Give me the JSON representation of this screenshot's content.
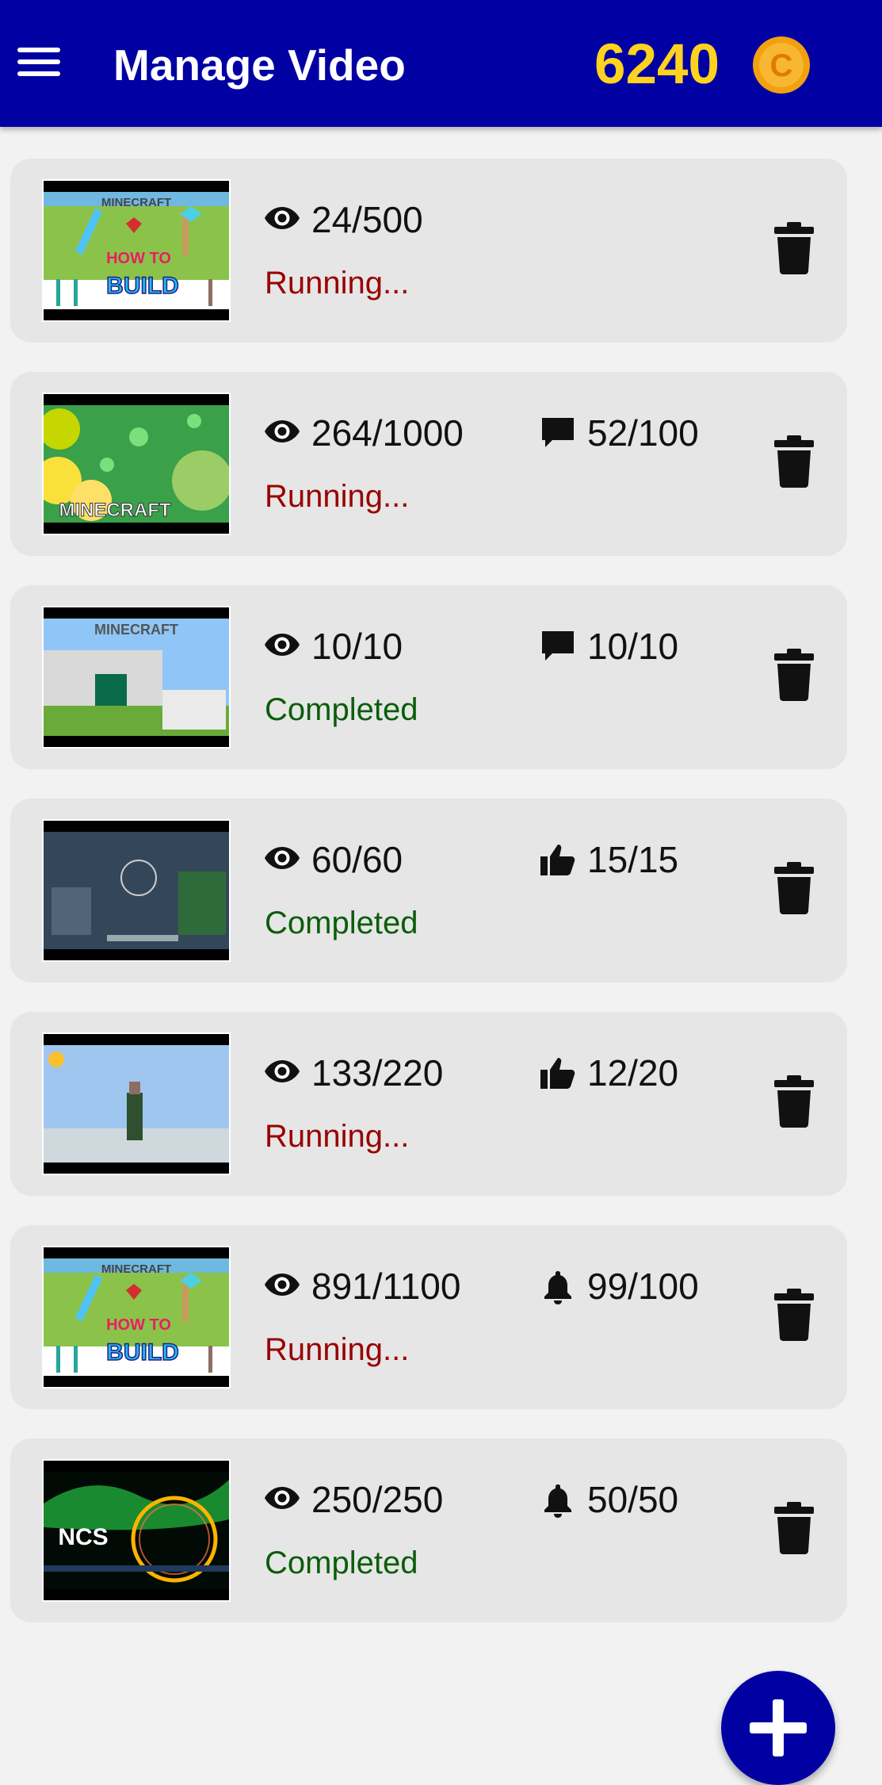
{
  "app": {
    "title": "Manage Video",
    "coins": "6240",
    "coin_symbol": "C"
  },
  "colors": {
    "appbar": "#0000a3",
    "coins": "#ffd21f",
    "running": "#990000",
    "completed": "#0b5d0b",
    "card": "#e6e6e6",
    "fab": "#0000a3"
  },
  "videos": [
    {
      "views": "24/500",
      "secondary": null,
      "status": "Running...",
      "state": "running",
      "thumb_label": "HOW TO BUILD"
    },
    {
      "views": "264/1000",
      "secondary": {
        "icon": "comment-icon",
        "value": "52/100"
      },
      "status": "Running...",
      "state": "running",
      "thumb_label": "MINECRAFT"
    },
    {
      "views": "10/10",
      "secondary": {
        "icon": "comment-icon",
        "value": "10/10"
      },
      "status": "Completed",
      "state": "completed",
      "thumb_label": "MINECRAFT"
    },
    {
      "views": "60/60",
      "secondary": {
        "icon": "thumbs-up-icon",
        "value": "15/15"
      },
      "status": "Completed",
      "state": "completed",
      "thumb_label": ""
    },
    {
      "views": "133/220",
      "secondary": {
        "icon": "thumbs-up-icon",
        "value": "12/20"
      },
      "status": "Running...",
      "state": "running",
      "thumb_label": ""
    },
    {
      "views": "891/1100",
      "secondary": {
        "icon": "bell-icon",
        "value": "99/100"
      },
      "status": "Running...",
      "state": "running",
      "thumb_label": "HOW TO BUILD"
    },
    {
      "views": "250/250",
      "secondary": {
        "icon": "bell-icon",
        "value": "50/50"
      },
      "status": "Completed",
      "state": "completed",
      "thumb_label": "NCS"
    }
  ]
}
